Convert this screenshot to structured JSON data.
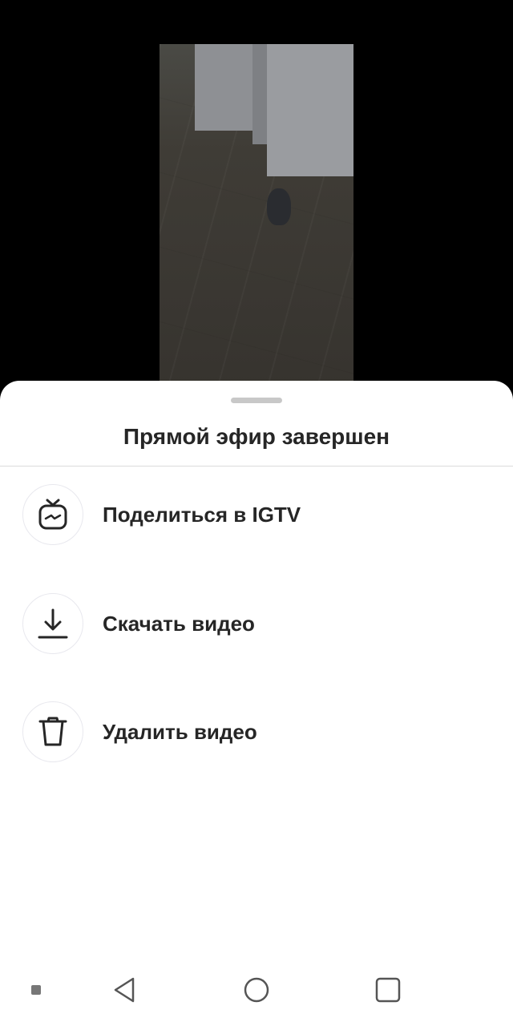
{
  "sheet": {
    "title": "Прямой эфир завершен"
  },
  "menu": [
    {
      "label": "Поделиться в IGTV",
      "icon": "igtv-icon"
    },
    {
      "label": "Скачать видео",
      "icon": "download-icon"
    },
    {
      "label": "Удалить видео",
      "icon": "trash-icon"
    }
  ],
  "navbar": {
    "icons": [
      "menu-dot-icon",
      "back-icon",
      "home-icon",
      "recents-icon"
    ]
  },
  "colors": {
    "text": "#262626",
    "sheet_bg": "#ffffff",
    "background": "#000000"
  }
}
